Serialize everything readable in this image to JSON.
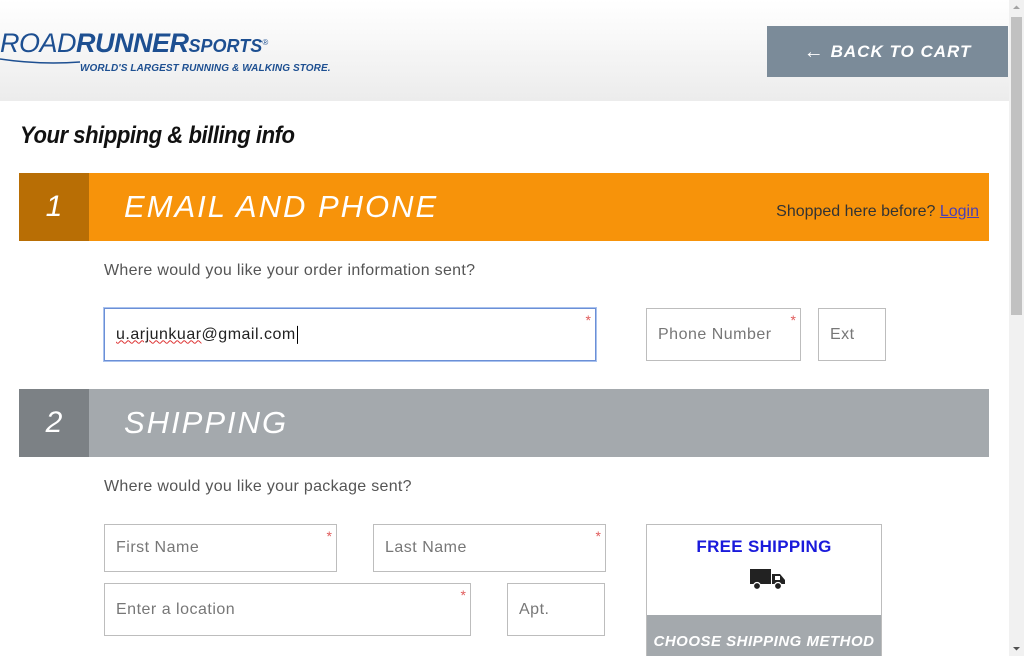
{
  "header": {
    "logo": {
      "road": "ROAD",
      "runner": "RUNNER",
      "sports": "SPORTS",
      "reg": "®",
      "tagline": "WORLD'S LARGEST RUNNING & WALKING STORE."
    },
    "back_button": {
      "arrow": "←",
      "label": "BACK TO CART"
    }
  },
  "page_title": "Your shipping & billing info",
  "section_email": {
    "number": "1",
    "label": "EMAIL AND PHONE",
    "shopped_text": "Shopped here before?",
    "login_link": "Login",
    "prompt": "Where would you like your order information sent?",
    "email": {
      "value_spell": "u.arjunkuar",
      "value_rest": "@gmail.com",
      "required": "*"
    },
    "phone": {
      "placeholder": "Phone Number",
      "required": "*"
    },
    "ext": {
      "placeholder": "Ext"
    }
  },
  "section_shipping": {
    "number": "2",
    "label": "SHIPPING",
    "prompt": "Where would you like your package sent?",
    "first_name": {
      "placeholder": "First Name",
      "required": "*"
    },
    "last_name": {
      "placeholder": "Last Name",
      "required": "*"
    },
    "location": {
      "placeholder": "Enter a location",
      "required": "*"
    },
    "apt": {
      "placeholder": "Apt."
    },
    "method": {
      "free_label": "FREE SHIPPING",
      "icon": "truck-icon",
      "choose_label": "CHOOSE SHIPPING METHOD"
    }
  },
  "colors": {
    "brand_blue": "#1d4f91",
    "orange": "#f7930a",
    "orange_dark": "#b86e05",
    "gray_bar": "#a4a9ad",
    "gray_dark": "#7c8185",
    "back_button": "#7b8b99",
    "free_shipping": "#1a1adb",
    "required": "#e05a5a"
  }
}
